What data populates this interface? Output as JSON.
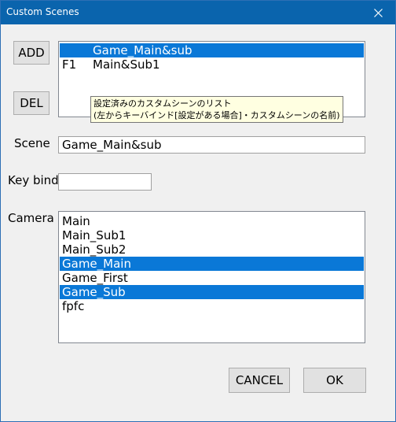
{
  "window": {
    "title": "Custom Scenes"
  },
  "buttons": {
    "add": "ADD",
    "del": "DEL",
    "cancel": "CANCEL",
    "ok": "OK"
  },
  "scene_list": {
    "items": [
      {
        "key": "",
        "name": "Game_Main&sub",
        "selected": true
      },
      {
        "key": "F1",
        "name": "Main&Sub1",
        "selected": false
      }
    ]
  },
  "tooltip": {
    "line1": "設定済みのカスタムシーンのリスト",
    "line2": "(左からキーバインド[設定がある場合]・カスタムシーンの名前)"
  },
  "scene": {
    "label": "Scene",
    "value": "Game_Main&sub"
  },
  "keybind": {
    "label": "Key bind",
    "value": ""
  },
  "camera": {
    "label": "Camera",
    "items": [
      {
        "name": "Main",
        "selected": false
      },
      {
        "name": "Main_Sub1",
        "selected": false
      },
      {
        "name": "Main_Sub2",
        "selected": false
      },
      {
        "name": "Game_Main",
        "selected": true
      },
      {
        "name": "Game_First",
        "selected": false
      },
      {
        "name": "Game_Sub",
        "selected": true
      },
      {
        "name": "fpfc",
        "selected": false
      }
    ]
  },
  "colors": {
    "titlebar": "#0a64ad",
    "selection": "#0a78d7",
    "tooltip_bg": "#ffffe1"
  }
}
